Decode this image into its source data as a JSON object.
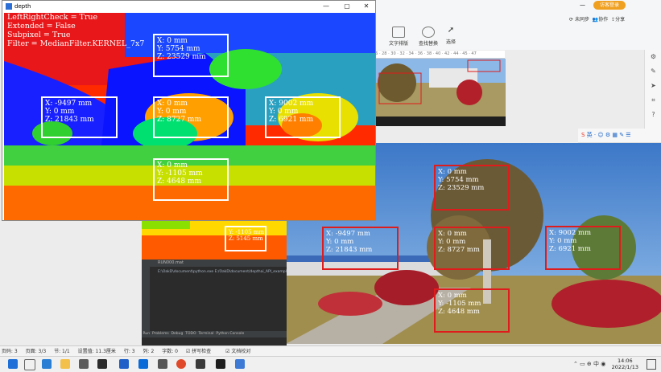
{
  "depth_window": {
    "title": "depth",
    "overlay_lines": [
      "LeftRightCheck = True",
      "Extended = False",
      "Subpixel = True",
      "Filter = MedianFilter.KERNEL_7x7"
    ],
    "boxes": [
      {
        "x": "X: 0 mm",
        "y": "Y: 5754 mm",
        "z": "Z: 23529 mm"
      },
      {
        "x": "X: -9497 mm",
        "y": "Y: 0 mm",
        "z": "Z: 21843 mm"
      },
      {
        "x": "X: 0 mm",
        "y": "Y: 0 mm",
        "z": "Z: 8727 mm"
      },
      {
        "x": "X: 9002 mm",
        "y": "Y: 0 mm",
        "z": "Z: 6921 mm"
      },
      {
        "x": "X: 0 mm",
        "y": "Y: -1105 mm",
        "z": "Z: 4648 mm"
      }
    ]
  },
  "rgb_window": {
    "boxes": [
      {
        "x": "X: 0 mm",
        "y": "Y: 5754 mm",
        "z": "Z: 23529 mm"
      },
      {
        "x": "X: -9497 mm",
        "y": "Y: 0 mm",
        "z": "Z: 21843 mm"
      },
      {
        "x": "X: 0 mm",
        "y": "Y: 0 mm",
        "z": "Z: 8727 mm"
      },
      {
        "x": "X: 9002 mm",
        "y": "Y: 0 mm",
        "z": "Z: 6921 mm"
      },
      {
        "x": "X: 0 mm",
        "y": "Y: -1105 mm",
        "z": "Z: 4648 mm"
      }
    ]
  },
  "mini_depth": {
    "line1": "Y: -1105 mm",
    "line2": "Z: 5145 mm"
  },
  "ribbon": {
    "login_label": "访客登录",
    "sync_label": "未同步",
    "collab_label": "协作",
    "share_label": "分享",
    "text_layout_label": "文字排版",
    "find_replace_label": "查找替换",
    "select_label": "选择"
  },
  "ruler_text": "26 · 28 · 30 · 32 · 34 · 36 · 38 · 40 · 42 · 44 · 45 · 47",
  "status_bar": {
    "page": "页码: 3",
    "pages": "页面: 3/3",
    "section": "节: 1/1",
    "setting": "设置值: 11.3厘米",
    "row": "行: 3",
    "col": "列: 2",
    "words": "字数: 0",
    "spell": "拼写检查",
    "proof": "文档校对"
  },
  "ide": {
    "tab_run": "Run",
    "tab_problems": "Problems",
    "tab_debug": "Debug",
    "tab_todo": "TODO",
    "tab_terminal": "Terminal",
    "tab_python_console": "Python Console",
    "file": "RUN000.mat",
    "path": "E:\\OakD\\document\\python.exe E:/OakD\\document/depthai_API_examples"
  },
  "taskbar": {
    "time": "14:06",
    "date": "2022/1/13"
  },
  "colors": {
    "accent": "#2b6fd6",
    "login": "#f0a020",
    "box_red": "#e01b1b"
  }
}
